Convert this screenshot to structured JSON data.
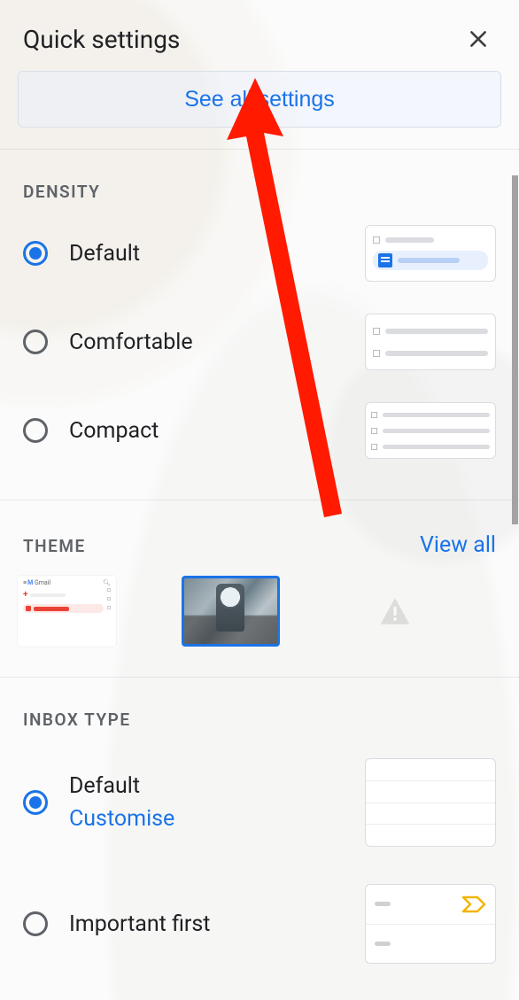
{
  "header": {
    "title": "Quick settings"
  },
  "see_all_label": "See all settings",
  "sections": {
    "density": {
      "title": "DENSITY",
      "options": {
        "default": "Default",
        "comfortable": "Comfortable",
        "compact": "Compact"
      }
    },
    "theme": {
      "title": "THEME",
      "view_all": "View all",
      "thumb_light_brand": "Gmail"
    },
    "inbox_type": {
      "title": "INBOX TYPE",
      "options": {
        "default_label": "Default",
        "default_customise": "Customise",
        "important_first": "Important first"
      }
    }
  }
}
